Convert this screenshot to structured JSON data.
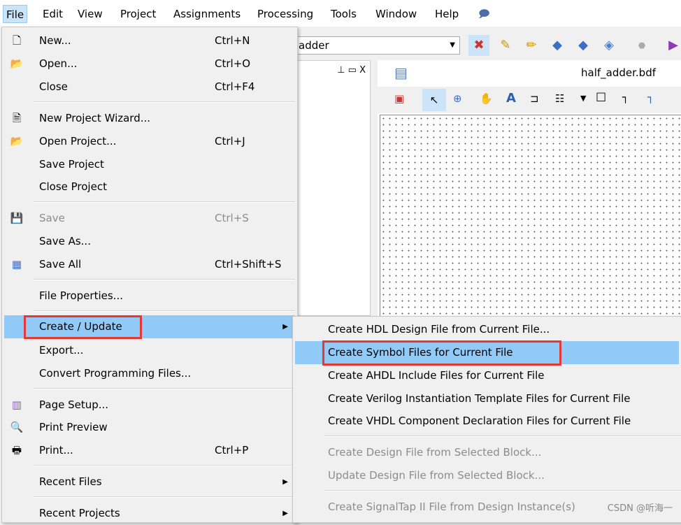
{
  "menubar": {
    "items": [
      "File",
      "Edit",
      "View",
      "Project",
      "Assignments",
      "Processing",
      "Tools",
      "Window",
      "Help"
    ],
    "active": "File"
  },
  "toolbar": {
    "combo_value": "adder"
  },
  "panel": {
    "controls": "⊥ ▭ X"
  },
  "document": {
    "tab_title": "half_adder.bdf"
  },
  "file_menu": {
    "items": [
      {
        "label": "New...",
        "shortcut": "Ctrl+N",
        "icon": "new-file-icon"
      },
      {
        "label": "Open...",
        "shortcut": "Ctrl+O",
        "icon": "open-folder-icon"
      },
      {
        "label": "Close",
        "shortcut": "Ctrl+F4"
      },
      {
        "label": "New Project Wizard...",
        "icon": "wizard-icon"
      },
      {
        "label": "Open Project...",
        "shortcut": "Ctrl+J",
        "icon": "open-project-icon"
      },
      {
        "label": "Save Project"
      },
      {
        "label": "Close Project"
      },
      {
        "label": "Save",
        "shortcut": "Ctrl+S",
        "icon": "save-icon",
        "disabled": true
      },
      {
        "label": "Save As..."
      },
      {
        "label": "Save All",
        "shortcut": "Ctrl+Shift+S",
        "icon": "save-all-icon"
      },
      {
        "label": "File Properties..."
      },
      {
        "label": "Create / Update",
        "submenu": true,
        "highlighted": true
      },
      {
        "label": "Export..."
      },
      {
        "label": "Convert Programming Files..."
      },
      {
        "label": "Page Setup...",
        "icon": "page-setup-icon"
      },
      {
        "label": "Print Preview",
        "icon": "print-preview-icon"
      },
      {
        "label": "Print...",
        "shortcut": "Ctrl+P",
        "icon": "printer-icon"
      },
      {
        "label": "Recent Files",
        "submenu": true
      },
      {
        "label": "Recent Projects",
        "submenu": true
      }
    ]
  },
  "submenu": {
    "items": [
      {
        "label": "Create HDL Design File from Current File..."
      },
      {
        "label": "Create Symbol Files for Current File",
        "highlighted": true
      },
      {
        "label": "Create AHDL Include Files for Current File"
      },
      {
        "label": "Create Verilog Instantiation Template Files for Current File"
      },
      {
        "label": "Create VHDL Component Declaration Files for Current File"
      },
      {
        "label": "Create Design File from Selected Block...",
        "disabled": true
      },
      {
        "label": "Update Design File from Selected Block...",
        "disabled": true
      },
      {
        "label": "Create SignalTap II File from Design Instance(s)",
        "disabled": true
      }
    ]
  },
  "watermark": "CSDN @听海一",
  "colors": {
    "highlight": "#91c9f7",
    "annotation": "#e53935"
  }
}
